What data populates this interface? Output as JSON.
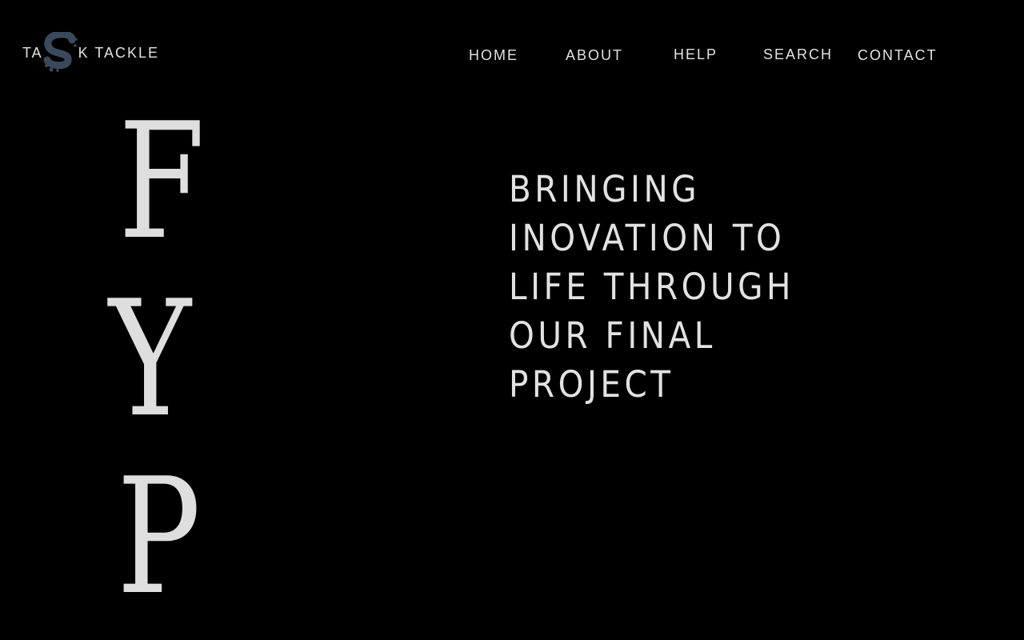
{
  "logo": {
    "text_before": "TA",
    "mark_letter": "S",
    "text_after": "K TACKLE",
    "mark_color": "#3a4a5c",
    "mark_icon": "s-logo-icon"
  },
  "nav": {
    "home": "HOME",
    "about": "ABOUT",
    "help": "HELP",
    "search": "SEARCH",
    "contact": "CONTACT"
  },
  "hero": {
    "letters": [
      "F",
      "Y",
      "P"
    ],
    "tagline_lines": [
      "BRINGING",
      "INOVATION TO",
      "LIFE THROUGH",
      "OUR FINAL",
      "PROJECT"
    ]
  },
  "colors": {
    "background": "#000000",
    "text": "#e2e2e2",
    "accent": "#3a4a5c"
  }
}
